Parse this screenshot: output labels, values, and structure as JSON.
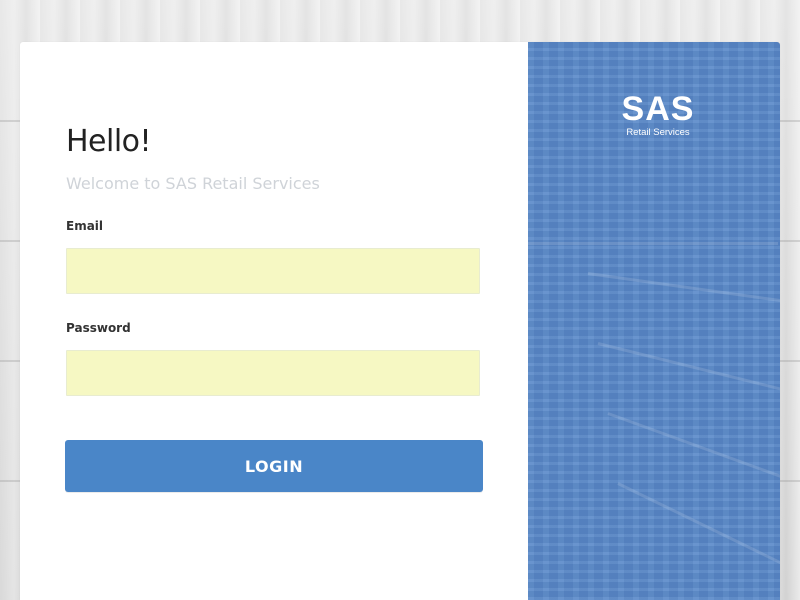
{
  "greeting": {
    "title": "Hello!",
    "subtitle": "Welcome to SAS Retail Services"
  },
  "form": {
    "email_label": "Email",
    "email_value": "",
    "email_placeholder": "",
    "password_label": "Password",
    "password_value": "",
    "password_placeholder": "",
    "login_label": "LOGIN"
  },
  "brand": {
    "logo_main": "SAS",
    "logo_sub": "Retail Services"
  },
  "colors": {
    "brand_panel": "#5b8ac9",
    "login_button": "#4a86c8",
    "input_autofill": "#f6f8c3",
    "subtitle_text": "#cfd3d8"
  }
}
